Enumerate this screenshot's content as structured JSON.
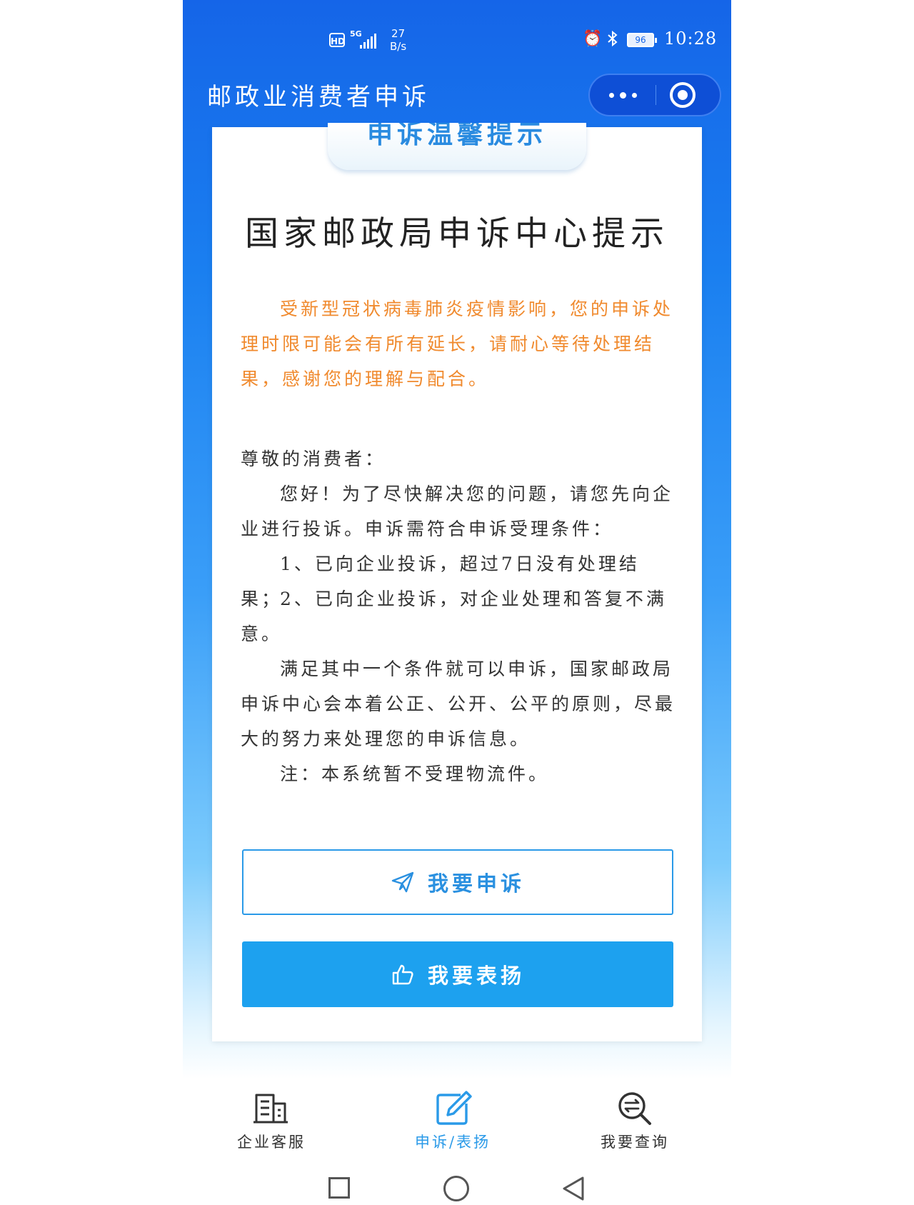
{
  "status_bar": {
    "hd": "HD",
    "network": "5G",
    "speed_value": "27",
    "speed_unit": "B/s",
    "battery": "96",
    "time": "10:28",
    "icons": [
      "alarm-icon",
      "bluetooth-icon",
      "battery-icon",
      "signal-icon"
    ]
  },
  "nav": {
    "title": "邮政业消费者申诉",
    "icons": [
      "more-icon",
      "close-target-icon"
    ]
  },
  "card": {
    "tab_title": "申诉温馨提示",
    "title": "国家邮政局申诉中心提示",
    "notice": "受新型冠状病毒肺炎疫情影响，您的申诉处理时限可能会有所有延长，请耐心等待处理结果，感谢您的理解与配合。",
    "greeting": "尊敬的消费者：",
    "p1": "您好！为了尽快解决您的问题，请您先向企业进行投诉。申诉需符合申诉受理条件：",
    "condition1": "1、已向企业投诉，超过7日没有处理结果；",
    "condition2": "2、已向企业投诉，对企业处理和答复不满意。",
    "p2": "满足其中一个条件就可以申诉，国家邮政局申诉中心会本着公正、公开、公平的原则，尽最大的努力来处理您的申诉信息。",
    "note": "注：本系统暂不受理物流件。"
  },
  "buttons": {
    "complain": "我要申诉",
    "praise": "我要表扬"
  },
  "tabbar": {
    "service": "企业客服",
    "complain": "申诉/表扬",
    "query": "我要查询",
    "active": "complain"
  },
  "colors": {
    "primary_blue": "#1565e8",
    "accent_blue": "#1da1ef",
    "notice_orange": "#f08a2e",
    "tab_active": "#2a9ae8"
  }
}
